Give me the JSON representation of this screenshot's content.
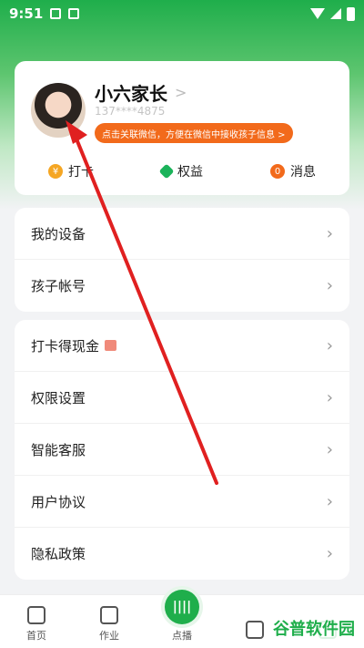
{
  "status_bar": {
    "time": "9:51"
  },
  "profile": {
    "name": "小六家长",
    "phone": "137****4875",
    "wechat_tip": "点击关联微信，方便在微信中接收孩子信息 >",
    "quick": [
      {
        "label": "打卡",
        "icon": "coin-icon",
        "glyph": "¥"
      },
      {
        "label": "权益",
        "icon": "gem-icon",
        "glyph": ""
      },
      {
        "label": "消息",
        "icon": "message-count-badge",
        "glyph": "0"
      }
    ]
  },
  "group1": [
    {
      "label": "我的设备"
    },
    {
      "label": "孩子帐号"
    }
  ],
  "group2": [
    {
      "label": "打卡得现金"
    },
    {
      "label": "权限设置"
    },
    {
      "label": "智能客服"
    },
    {
      "label": "用户协议"
    },
    {
      "label": "隐私政策"
    }
  ],
  "tabbar": {
    "home": "首页",
    "homework": "作业",
    "play": "点播"
  },
  "watermark": "谷普软件园",
  "colors": {
    "brand": "#1fae4b",
    "accent": "#f26a1b",
    "annotation": "#e02020"
  }
}
